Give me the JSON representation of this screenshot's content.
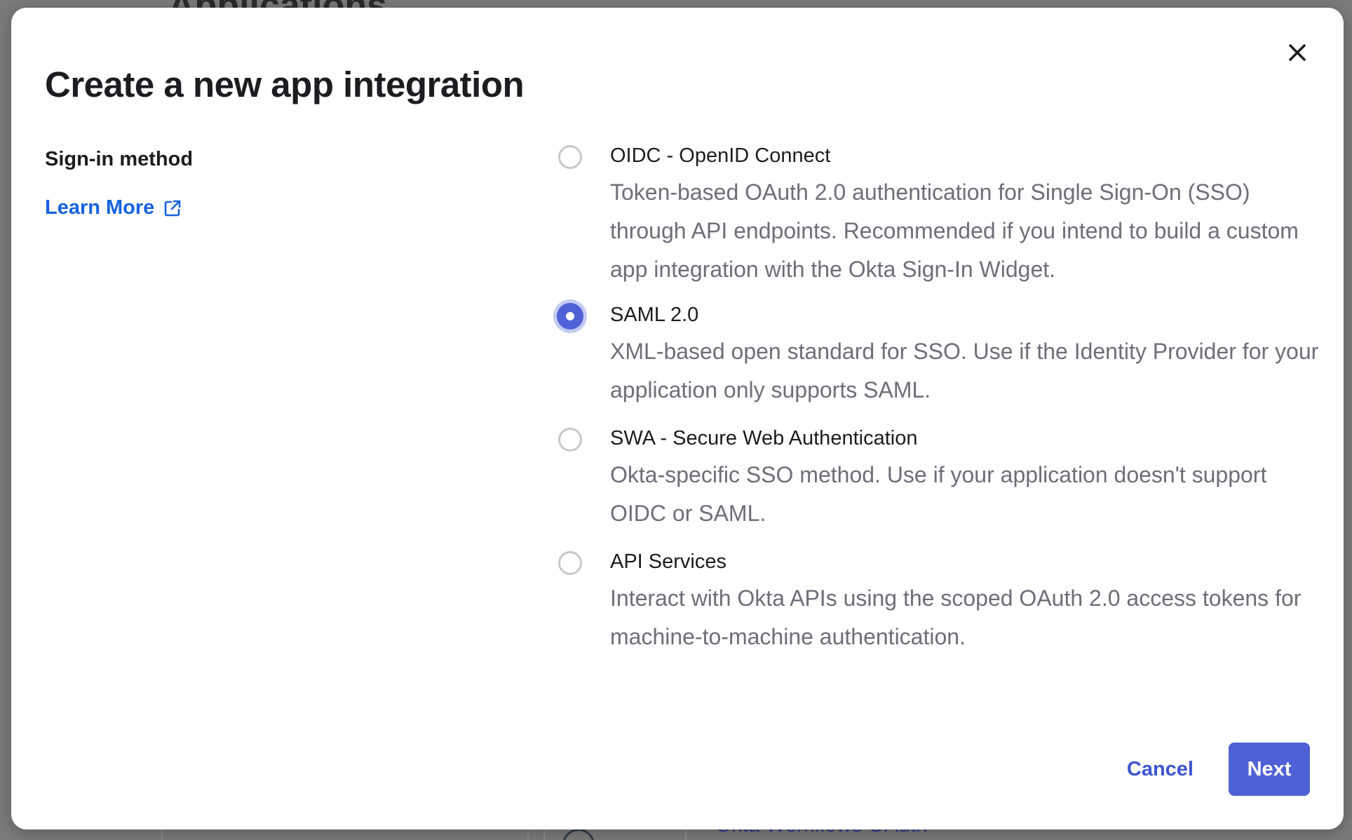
{
  "background": {
    "heading": "Applications",
    "card_text": "Okta Workflows OAuth"
  },
  "dialog": {
    "title": "Create a new app integration",
    "close_icon": "close-icon",
    "section_label": "Sign-in method",
    "learn_more": "Learn More",
    "learn_more_icon": "external-link-icon",
    "accent_color": "#4f61d6",
    "link_color": "#1662dd",
    "selected_option": "SAML 2.0",
    "options": [
      {
        "label": "OIDC - OpenID Connect",
        "description": "Token-based OAuth 2.0 authentication for Single Sign-On (SSO) through API endpoints. Recommended if you intend to build a custom app integration with the Okta Sign-In Widget.",
        "checked": false
      },
      {
        "label": "SAML 2.0",
        "description": "XML-based open standard for SSO. Use if the Identity Provider for your application only supports SAML.",
        "checked": true
      },
      {
        "label": "SWA - Secure Web Authentication",
        "description": "Okta-specific SSO method. Use if your application doesn't support OIDC or SAML.",
        "checked": false
      },
      {
        "label": "API Services",
        "description": "Interact with Okta APIs using the scoped OAuth 2.0 access tokens for machine-to-machine authentication.",
        "checked": false
      }
    ],
    "cancel_label": "Cancel",
    "next_label": "Next"
  }
}
